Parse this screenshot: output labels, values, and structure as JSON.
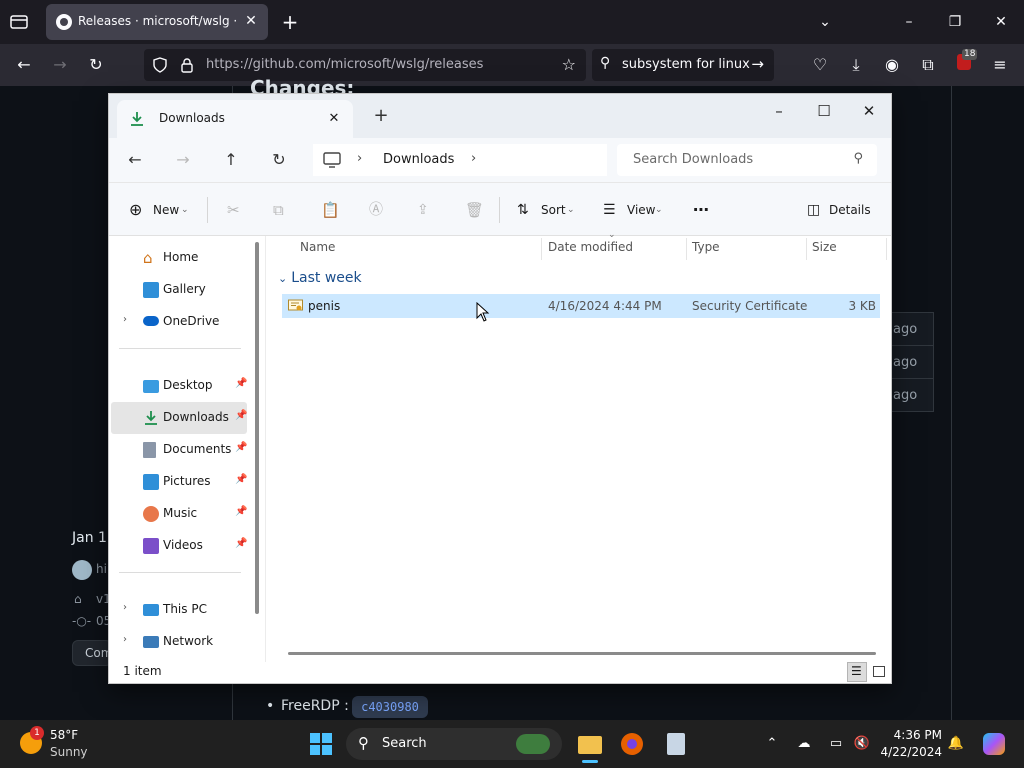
{
  "browser": {
    "tab_title": "Releases · microsoft/wslg · GitHub",
    "url": "https://github.com/microsoft/wslg/releases",
    "search_pill": "subsystem for linux",
    "extension_badge": "18"
  },
  "page": {
    "changes_heading": "Changes:",
    "ago": [
      "ago",
      "ago",
      "ago"
    ],
    "date_stub": "Jan 1",
    "avatar_stub": "hi",
    "tag_stub": "v1",
    "commit_stub": "05",
    "compare_stub": "Com",
    "freerdp_label": "FreeRDP :",
    "freerdp_commit": "c4030980"
  },
  "explorer": {
    "tab_title": "Downloads",
    "breadcrumb": "Downloads",
    "search_placeholder": "Search Downloads",
    "commands": {
      "new": "New",
      "sort": "Sort",
      "view": "View",
      "details": "Details"
    },
    "sidebar": {
      "home": "Home",
      "gallery": "Gallery",
      "onedrive": "OneDrive",
      "desktop": "Desktop",
      "downloads": "Downloads",
      "documents": "Documents",
      "pictures": "Pictures",
      "music": "Music",
      "videos": "Videos",
      "this_pc": "This PC",
      "network": "Network"
    },
    "columns": {
      "name": "Name",
      "date": "Date modified",
      "type": "Type",
      "size": "Size"
    },
    "group": "Last week",
    "files": [
      {
        "name": "penis",
        "date": "4/16/2024 4:44 PM",
        "type": "Security Certificate",
        "size": "3 KB"
      }
    ],
    "status": "1 item"
  },
  "taskbar": {
    "weather_temp": "58°F",
    "weather_cond": "Sunny",
    "weather_badge": "1",
    "search": "Search",
    "time": "4:36 PM",
    "date": "4/22/2024"
  },
  "colors": {
    "selection": "#cce8ff",
    "group_header": "#1b4e8c",
    "taskbar": "#202020"
  }
}
